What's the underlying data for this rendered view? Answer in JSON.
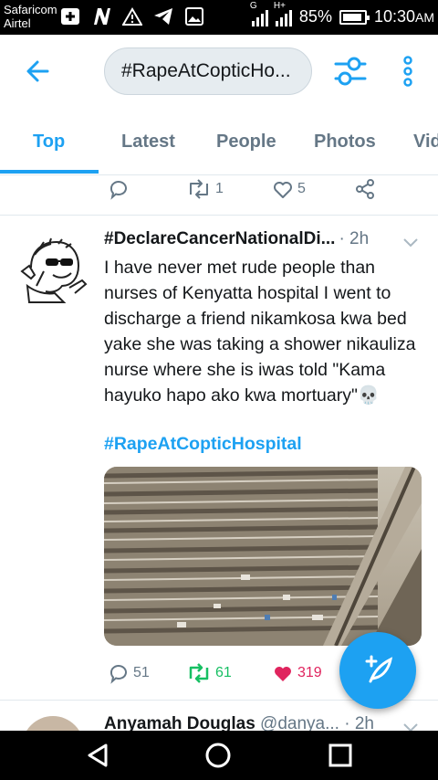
{
  "status_bar": {
    "carrier_line1": "Safaricom",
    "carrier_line2": "Airtel",
    "network_badge_1": "G",
    "network_badge_2": "H+",
    "battery": "85%",
    "time": "10:30",
    "time_suffix": "AM",
    "icons": [
      "plus-box-icon",
      "n-app-icon",
      "warning-icon",
      "telegram-icon",
      "image-icon"
    ]
  },
  "search": {
    "query": "#RapeAtCopticHo..."
  },
  "tabs": [
    "Top",
    "Latest",
    "People",
    "Photos",
    "Vid"
  ],
  "prev_tweet": {
    "retweets": "1",
    "likes": "5"
  },
  "tweet": {
    "name": "#DeclareCancerNationalDi...",
    "time": "· 2h",
    "text": "I have never met rude people than nurses of Kenyatta hospital I went to discharge a friend nikamkosa kwa bed yake she was taking a shower nikauliza nurse where she is iwas told \"Kama hayuko hapo ako kwa mortuary\"💀",
    "hashtag": "#RapeAtCopticHospital",
    "replies": "51",
    "retweets": "61",
    "likes": "319"
  },
  "next_tweet": {
    "name": "Anyamah Douglas",
    "handle": "@danya...",
    "time": "· 2h"
  },
  "colors": {
    "accent": "#1da1f2",
    "retweet_green": "#17bf63",
    "like_red": "#e0245e",
    "secondary_text": "#657786"
  }
}
